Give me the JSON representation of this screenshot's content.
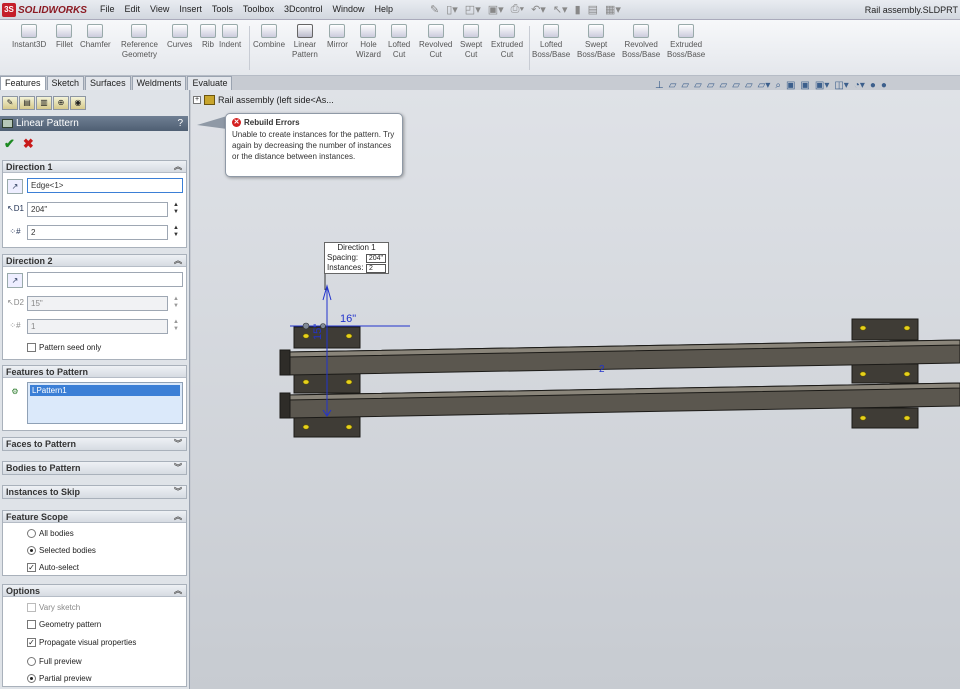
{
  "app": {
    "logo_text": "SOLIDWORKS",
    "logo_icon": "3S",
    "document_title": "Rail assembly.SLDPRT"
  },
  "menu": [
    "File",
    "Edit",
    "View",
    "Insert",
    "Tools",
    "Toolbox",
    "3Dcontrol",
    "Window",
    "Help"
  ],
  "ribbon": {
    "instant3d": "Instant3D",
    "fillet": "Fillet",
    "chamfer": "Chamfer",
    "reference_geometry": [
      "Reference",
      "Geometry"
    ],
    "curves": "Curves",
    "rib": "Rib",
    "indent": "Indent",
    "combine": "Combine",
    "linear_pattern": [
      "Linear",
      "Pattern"
    ],
    "mirror": "Mirror",
    "hole_wizard": [
      "Hole",
      "Wizard"
    ],
    "lofted_cut": [
      "Lofted",
      "Cut"
    ],
    "revolved_cut": [
      "Revolved",
      "Cut"
    ],
    "swept_cut": [
      "Swept",
      "Cut"
    ],
    "extruded_cut": [
      "Extruded",
      "Cut"
    ],
    "lofted_boss": [
      "Lofted",
      "Boss/Base"
    ],
    "swept_boss": [
      "Swept",
      "Boss/Base"
    ],
    "revolved_boss": [
      "Revolved",
      "Boss/Base"
    ],
    "extruded_boss": [
      "Extruded",
      "Boss/Base"
    ]
  },
  "tabs": [
    "Features",
    "Sketch",
    "Surfaces",
    "Weldments",
    "Evaluate"
  ],
  "property_manager": {
    "title": "Linear Pattern",
    "help": "?",
    "ok": "✔",
    "cancel": "✖",
    "direction1": {
      "header": "Direction 1",
      "edge": "Edge<1>",
      "spacing": "204\"",
      "instances": "2"
    },
    "direction2": {
      "header": "Direction 2",
      "edge": "",
      "spacing": "15\"",
      "instances": "1",
      "pattern_seed_only": "Pattern seed only"
    },
    "features_to_pattern": {
      "header": "Features to Pattern",
      "item": "LPattern1"
    },
    "faces_to_pattern": "Faces to Pattern",
    "bodies_to_pattern": "Bodies to Pattern",
    "instances_to_skip": "Instances to Skip",
    "feature_scope": {
      "header": "Feature Scope",
      "all_bodies": "All bodies",
      "selected_bodies": "Selected bodies",
      "auto_select": "Auto-select"
    },
    "options": {
      "header": "Options",
      "vary_sketch": "Vary sketch",
      "geometry_pattern": "Geometry pattern",
      "propagate": "Propagate visual properties",
      "full_preview": "Full preview",
      "partial_preview": "Partial preview"
    }
  },
  "tree": {
    "label": "Rail assembly  (left side<As..."
  },
  "error": {
    "title": "Rebuild Errors",
    "message": "Unable to create instances for the pattern. Try again by decreasing the number of instances or the distance between instances."
  },
  "callout": {
    "title": "Direction 1",
    "spacing_label": "Spacing:",
    "spacing_value": "204\"",
    "instances_label": "Instances:",
    "instances_value": "2"
  },
  "dimensions": {
    "horizontal": "16\"",
    "vertical": "15\"",
    "count_label": "2"
  }
}
